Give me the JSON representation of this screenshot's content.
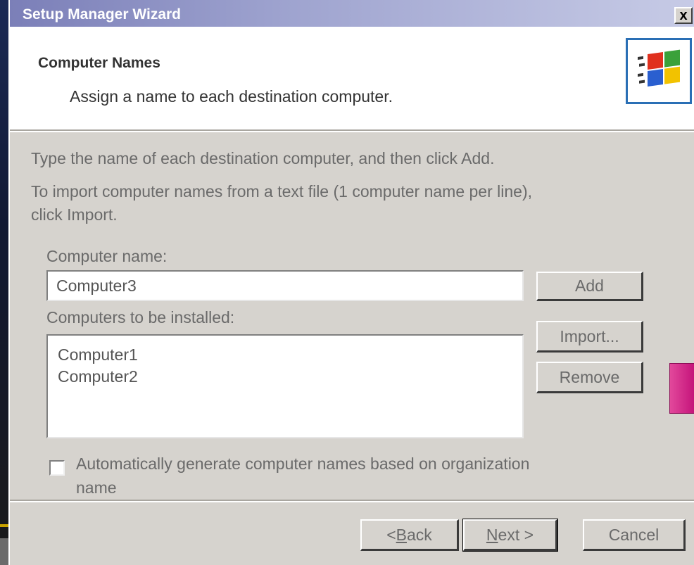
{
  "window": {
    "title": "Setup Manager Wizard",
    "close_glyph": "x"
  },
  "header": {
    "title": "Computer Names",
    "subtitle": "Assign a name to each destination computer.",
    "logo_icon": "windows-flag-icon"
  },
  "instructions": {
    "line1": "Type the name of each destination computer, and then click Add.",
    "line2a": "To import computer names from a text file (1 computer name per line),",
    "line2b": "click Import."
  },
  "computer_name": {
    "label": "Computer name:",
    "value": "Computer3"
  },
  "computers_list": {
    "label": "Computers to be installed:",
    "items": [
      "Computer1",
      "Computer2"
    ]
  },
  "buttons": {
    "add": "Add",
    "import": "Import...",
    "remove": "Remove"
  },
  "auto_generate": {
    "checked": false,
    "label_line1": "Automatically generate computer names based on organization",
    "label_line2": "name"
  },
  "footer": {
    "back_prefix": "<",
    "back_mnemonic": "B",
    "back_rest": "ack",
    "next_mnemonic": "N",
    "next_rest": "ext >",
    "cancel": "Cancel"
  },
  "colors": {
    "title_bar_start": "#7b7fb8",
    "dialog_bg": "#d6d3ce",
    "side_tab": "#d62c8c"
  }
}
